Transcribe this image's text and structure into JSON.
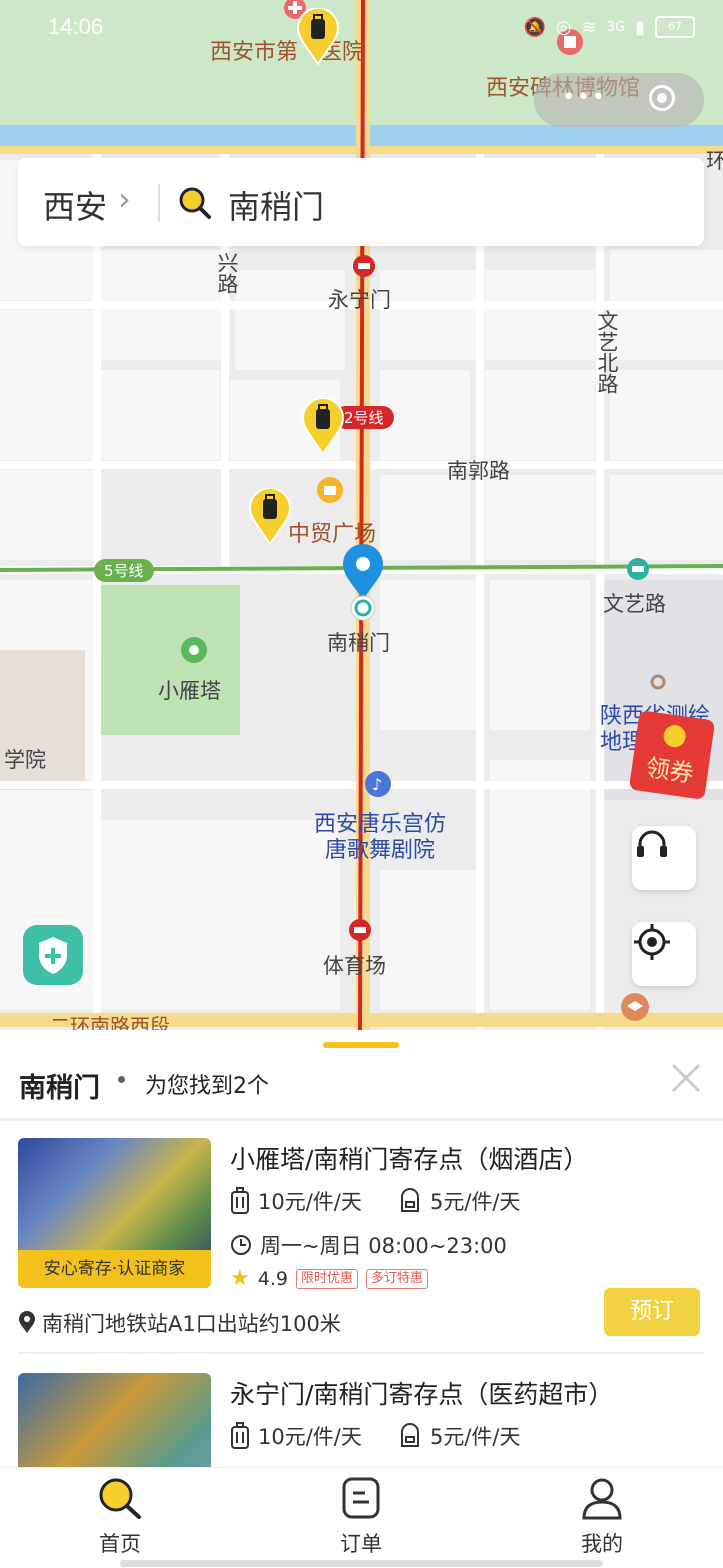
{
  "status_bar": {
    "time": "14:06",
    "battery": "67",
    "network": "3G"
  },
  "search": {
    "city": "西安",
    "query": "南稍门"
  },
  "map": {
    "labels": {
      "hospital": "西安市第　医院",
      "museum": "西安碑林博物馆",
      "yongningmen": "永宁门",
      "xing_road": "兴路",
      "wenyi_north": "文艺北路",
      "nanguo_road": "南郭路",
      "zhongmao": "中贸广场",
      "nanshaomen": "南稍门",
      "wenyi_road": "文艺路",
      "xiaoyanta": "小雁塔",
      "college": "学院",
      "survey": "陕西省测绘地理",
      "tangyue": "西安唐乐宫仿唐歌舞剧院",
      "tiyuchang": "体育场",
      "second_ring": "二环南路西段",
      "huan": "环"
    },
    "lines": {
      "line2": "2号线",
      "line5": "5号线"
    },
    "coupon": "领券"
  },
  "sheet": {
    "title": "南稍门",
    "found": "为您找到2个",
    "results": [
      {
        "name": "小雁塔/南稍门寄存点（烟酒店）",
        "price_luggage": "10元/件/天",
        "price_bag": "5元/件/天",
        "hours": "周一~周日 08:00~23:00",
        "rating": "4.9",
        "promo1": "限时优惠",
        "promo2": "多订特惠",
        "badge": "安心寄存·认证商家",
        "address": "南稍门地铁站A1口出站约100米",
        "book_label": "预订"
      },
      {
        "name": "永宁门/南稍门寄存点（医药超市）",
        "price_luggage": "10元/件/天",
        "price_bag": "5元/件/天"
      }
    ]
  },
  "tabbar": {
    "home": "首页",
    "orders": "订单",
    "mine": "我的"
  },
  "colors": {
    "accent": "#f2c21b",
    "metro_red": "#d3272b",
    "metro_green": "#6ab04c",
    "pin_blue": "#1e90e0"
  }
}
